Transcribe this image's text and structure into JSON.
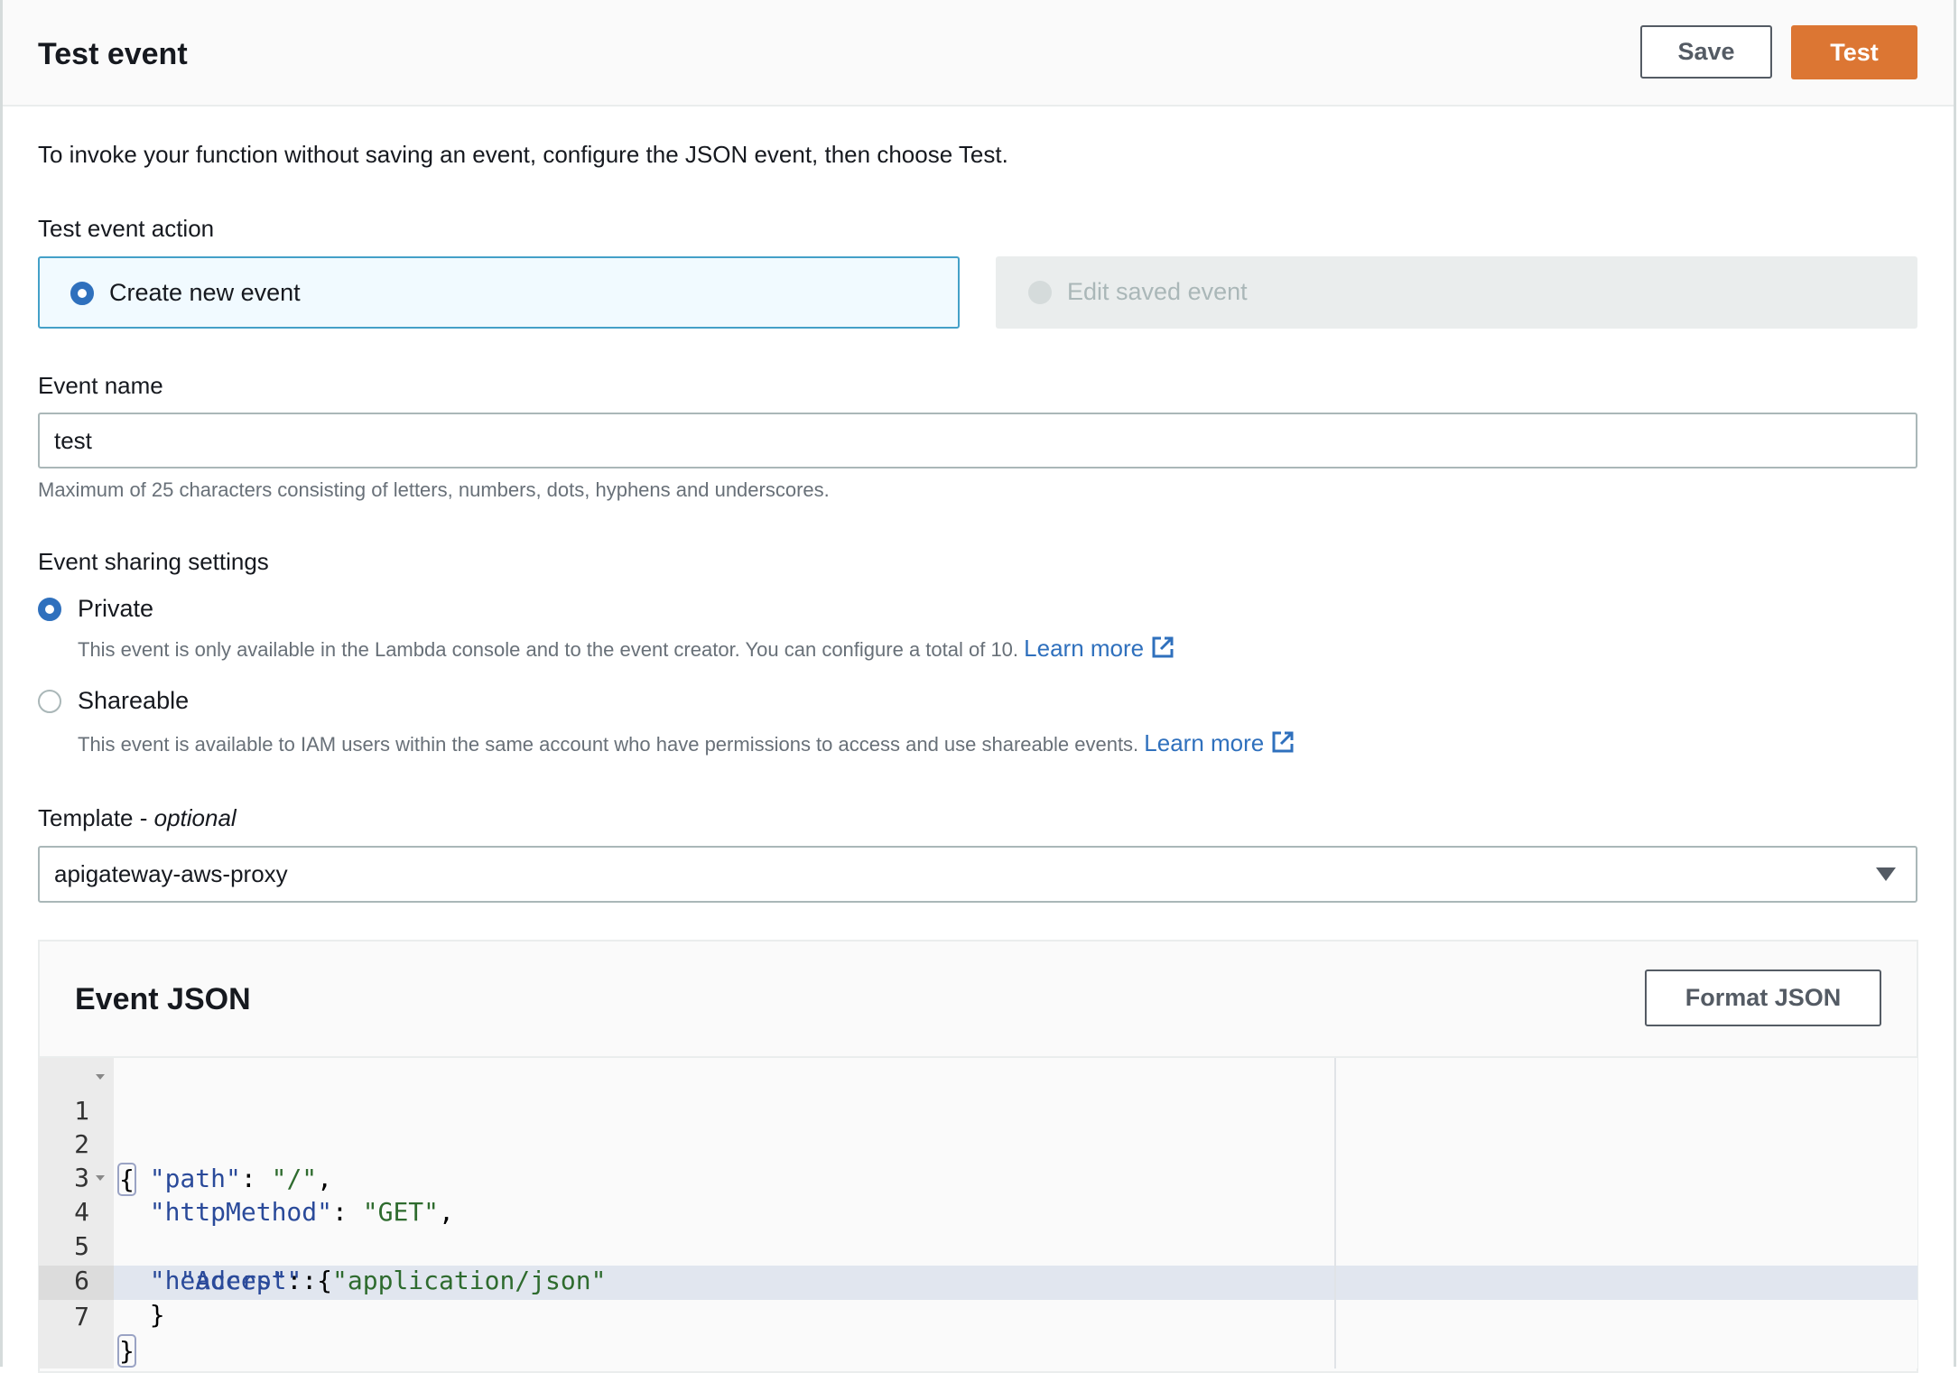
{
  "header": {
    "title": "Test event",
    "save_label": "Save",
    "test_label": "Test",
    "accent_color": "#dc7633"
  },
  "intro": "To invoke your function without saving an event, configure the JSON event, then choose Test.",
  "test_event_action": {
    "label": "Test event action",
    "options": [
      {
        "label": "Create new event",
        "selected": true,
        "disabled": false
      },
      {
        "label": "Edit saved event",
        "selected": false,
        "disabled": true
      }
    ]
  },
  "event_name": {
    "label": "Event name",
    "value": "test",
    "hint": "Maximum of 25 characters consisting of letters, numbers, dots, hyphens and underscores."
  },
  "sharing": {
    "label": "Event sharing settings",
    "options": [
      {
        "label": "Private",
        "selected": true,
        "description": "This event is only available in the Lambda console and to the event creator. You can configure a total of 10.",
        "link": "Learn more"
      },
      {
        "label": "Shareable",
        "selected": false,
        "description": "This event is available to IAM users within the same account who have permissions to access and use shareable events.",
        "link": "Learn more"
      }
    ]
  },
  "template": {
    "label": "Template - ",
    "label_optional": "optional",
    "selected": "apigateway-aws-proxy"
  },
  "event_json": {
    "title": "Event JSON",
    "format_label": "Format JSON",
    "lines": [
      {
        "n": "1",
        "foldable": true
      },
      {
        "n": "2",
        "foldable": false
      },
      {
        "n": "3",
        "foldable": false
      },
      {
        "n": "4",
        "foldable": true
      },
      {
        "n": "5",
        "foldable": false
      },
      {
        "n": "6",
        "foldable": false
      },
      {
        "n": "7",
        "foldable": false
      }
    ],
    "tokens": {
      "l1_open": "{",
      "l2_key": "\"path\"",
      "l2_sep": ": ",
      "l2_val": "\"/\"",
      "l2_end": ",",
      "l3_key": "\"httpMethod\"",
      "l3_sep": ": ",
      "l3_val": "\"GET\"",
      "l3_end": ",",
      "l4_key": "\"headers\"",
      "l4_sep": ": {",
      "l5_key": "\"Accept\"",
      "l5_sep": ": ",
      "l5_val": "\"application/json\"",
      "l6_close": "}",
      "l7_close": "}"
    },
    "active_line": 7
  }
}
